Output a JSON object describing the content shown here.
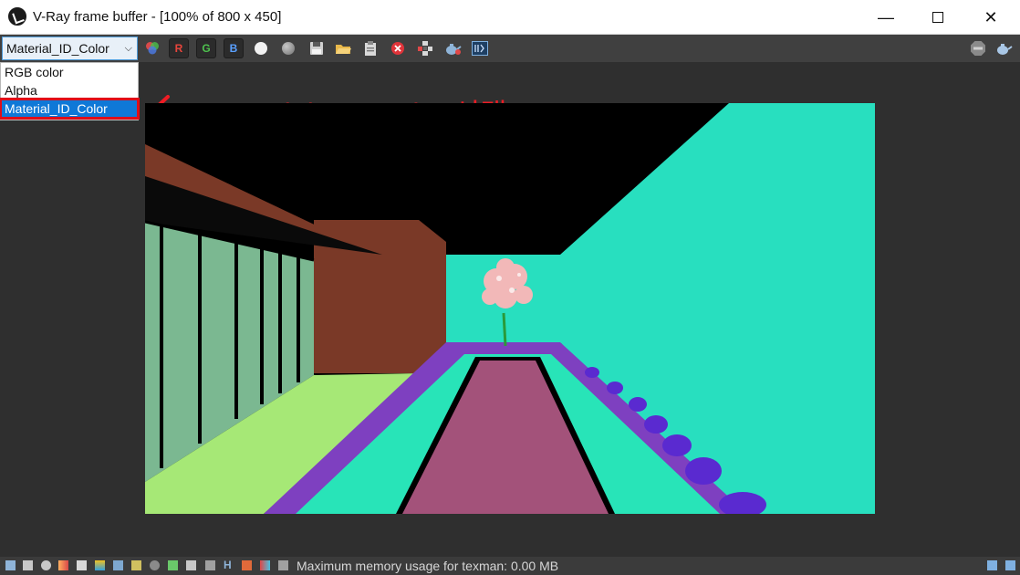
{
  "window": {
    "title": "V-Ray frame buffer - [100% of 800 x 450]",
    "minimize_glyph": "—",
    "close_glyph": "✕"
  },
  "toolbar": {
    "channel_value": "Material_ID_Color",
    "red_label": "R",
    "green_label": "G",
    "blue_label": "B"
  },
  "dropdown": {
    "options": [
      "RGB color",
      "Alpha",
      "Material_ID_Color"
    ],
    "selected": "Material_ID_Color"
  },
  "annotation": {
    "text": "Material_ID_Color 선택",
    "color": "#ee1c24"
  },
  "status": {
    "text": "Maximum memory usage for texman: 0.00 MB",
    "h_label": "H"
  },
  "colors": {
    "toolbar_bg": "#404040",
    "selection_blue": "#0f78d7",
    "highlight_red": "#e00d18"
  },
  "icons": [
    "vray-logo-icon",
    "color-correction-icon",
    "white-circle-icon",
    "gray-circle-icon",
    "save-icon",
    "open-icon",
    "clipboard-icon",
    "clear-icon",
    "track-mouse-icon",
    "render-teapot-icon",
    "vfb-history-icon",
    "stop-icon",
    "render-icon"
  ]
}
